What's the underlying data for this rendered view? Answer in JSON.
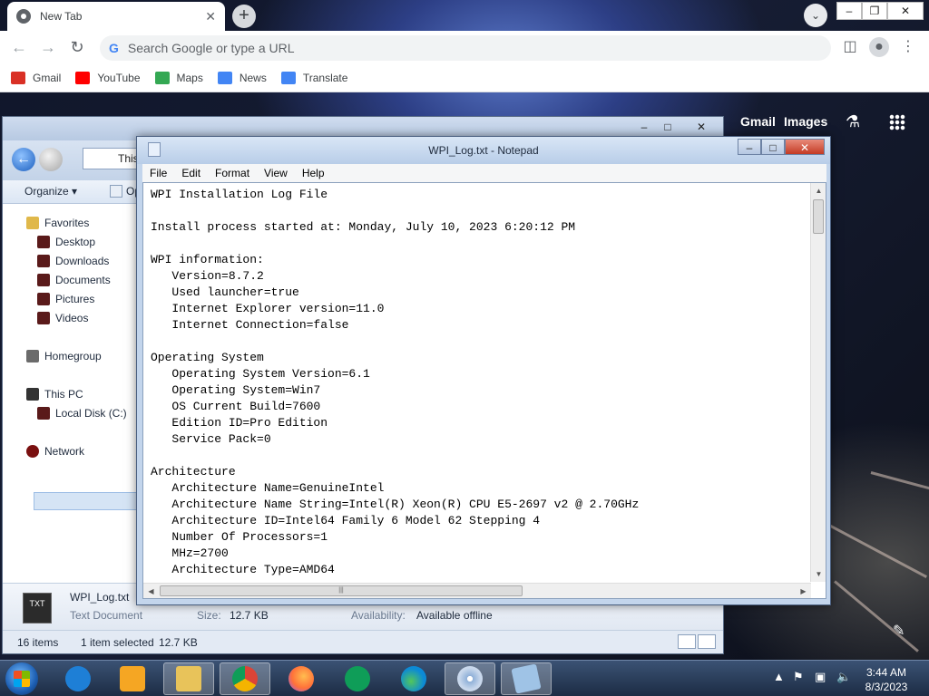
{
  "chrome": {
    "tab_title": "New Tab",
    "omnibox_placeholder": "Search Google or type a URL",
    "bookmarks": [
      {
        "label": "Gmail",
        "color": "#d93025"
      },
      {
        "label": "YouTube",
        "color": "#ff0000"
      },
      {
        "label": "Maps",
        "color": "#34a853"
      },
      {
        "label": "News",
        "color": "#4285f4"
      },
      {
        "label": "Translate",
        "color": "#4285f4"
      }
    ],
    "page_links": {
      "gmail": "Gmail",
      "images": "Images"
    }
  },
  "explorer": {
    "address": "This",
    "organize": "Organize ▾",
    "open_label": "Op",
    "nav": {
      "favorites": "Favorites",
      "desktop": "Desktop",
      "downloads": "Downloads",
      "documents": "Documents",
      "pictures": "Pictures",
      "videos": "Videos",
      "homegroup": "Homegroup",
      "this_pc": "This PC",
      "local_disk": "Local Disk (C:)",
      "network": "Network"
    },
    "details": {
      "file_name": "WPI_Log.txt",
      "file_type": "Text Document",
      "size_label": "Size:",
      "size_value": "12.7 KB",
      "availability_label": "Availability:",
      "availability_value": "Available offline",
      "icon_text": "TXT"
    },
    "status": {
      "items": "16 items",
      "selected": "1 item selected",
      "selected_size": "12.7 KB"
    }
  },
  "notepad": {
    "title": "WPI_Log.txt - Notepad",
    "menu": [
      "File",
      "Edit",
      "Format",
      "View",
      "Help"
    ],
    "lines": [
      "WPI Installation Log File",
      "",
      "Install process started at: Monday, July 10, 2023 6:20:12 PM",
      "",
      "WPI information:",
      "   Version=8.7.2",
      "   Used launcher=true",
      "   Internet Explorer version=11.0",
      "   Internet Connection=false",
      "",
      "Operating System",
      "   Operating System Version=6.1",
      "   Operating System=Win7",
      "   OS Current Build=7600",
      "   Edition ID=Pro Edition",
      "   Service Pack=0",
      "",
      "Architecture",
      "   Architecture Name=GenuineIntel",
      "   Architecture Name String=Intel(R) Xeon(R) CPU E5-2697 v2 @ 2.70GHz",
      "   Architecture ID=Intel64 Family 6 Model 62 Stepping 4",
      "   Number Of Processors=1",
      "   MHz=2700",
      "   Architecture Type=AMD64"
    ]
  },
  "taskbar": {
    "time": "3:44 AM",
    "date": "8/3/2023",
    "apps": [
      {
        "name": "Internet Explorer",
        "color": "#1e7fd6"
      },
      {
        "name": "Media Player",
        "color": "#f5a623"
      },
      {
        "name": "File Explorer",
        "color": "#e8c35a"
      },
      {
        "name": "Google Chrome",
        "color": "#db4437"
      },
      {
        "name": "Firefox",
        "color": "#ff7139"
      },
      {
        "name": "Google Sheets",
        "color": "#0f9d58"
      },
      {
        "name": "Microsoft Edge",
        "color": "#0c8ad6"
      },
      {
        "name": "Setup Disc",
        "color": "#8fb0d8"
      },
      {
        "name": "Notepad",
        "color": "#9fc3e6"
      }
    ]
  }
}
